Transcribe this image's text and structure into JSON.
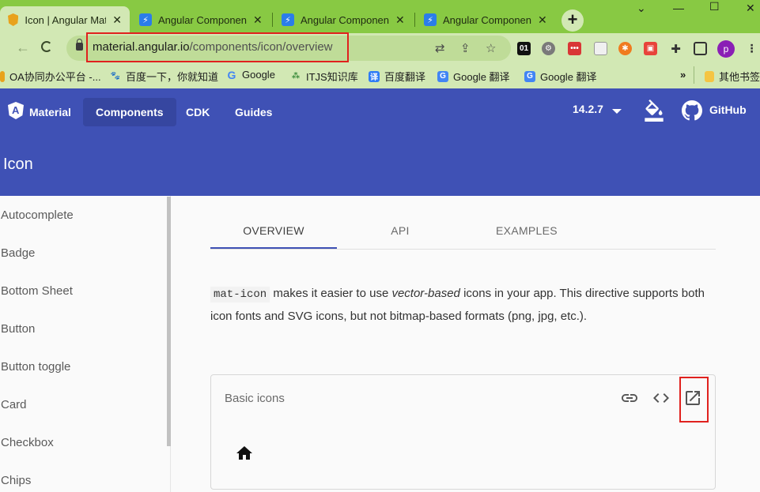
{
  "browser": {
    "tabs": [
      {
        "title": "Icon | Angular Material",
        "favicon": "angular-icon",
        "active": true
      },
      {
        "title": "Angular Components",
        "favicon": "lightning-icon",
        "active": false
      },
      {
        "title": "Angular Components",
        "favicon": "lightning-icon",
        "active": false
      },
      {
        "title": "Angular Components",
        "favicon": "lightning-icon",
        "active": false
      }
    ],
    "new_tab_label": "+",
    "url": {
      "host": "material.angular.io",
      "path": "/components/icon/overview"
    },
    "profile_initial": "p",
    "extension_label": "01",
    "bookmarks": [
      {
        "label": "OA协同办公平台 -...",
        "icon": "folder-icon"
      },
      {
        "label": "百度一下，你就知道",
        "icon": "baidu-icon"
      },
      {
        "label": "Google",
        "icon": "google-icon"
      },
      {
        "label": "ITJS知识库",
        "icon": "itjs-icon"
      },
      {
        "label": "百度翻译",
        "icon": "translate-icon"
      },
      {
        "label": "Google 翻译",
        "icon": "google-translate-icon"
      },
      {
        "label": "Google 翻译",
        "icon": "google-translate-icon"
      }
    ],
    "bookmarks_more": "»",
    "other_bookmarks": "其他书签"
  },
  "site": {
    "nav": {
      "brand": "Material",
      "components": "Components",
      "cdk": "CDK",
      "guides": "Guides",
      "version": "14.2.7",
      "github": "GitHub"
    },
    "page_title": "Icon",
    "sidenav": [
      "Autocomplete",
      "Badge",
      "Bottom Sheet",
      "Button",
      "Button toggle",
      "Card",
      "Checkbox",
      "Chips"
    ],
    "tabs": [
      "OVERVIEW",
      "API",
      "EXAMPLES"
    ],
    "intro": {
      "code": "mat-icon",
      "part1": " makes it easier to use ",
      "emphasis": "vector-based",
      "part2": " icons in your app. This directive supports both icon fonts and SVG icons, but not bitmap-based formats (png, jpg, etc.)."
    },
    "example": {
      "title": "Basic icons"
    }
  },
  "colors": {
    "primary": "#3f51b5",
    "chrome": "#88c943",
    "highlight": "#e0211e"
  }
}
